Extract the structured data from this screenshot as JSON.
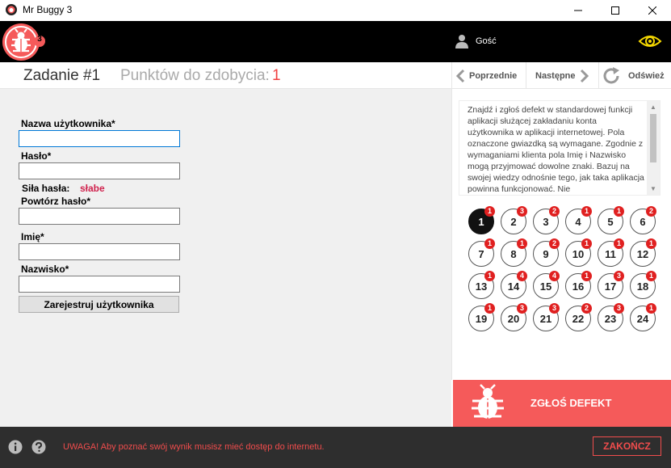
{
  "window": {
    "title": "Mr Buggy 3"
  },
  "header": {
    "logo_badge": "3",
    "user_name": "Gość"
  },
  "task": {
    "title": "Zadanie #1",
    "points_label": "Punktów do zdobycia:",
    "points_value": "1"
  },
  "nav": {
    "prev": "Poprzednie",
    "next": "Następne",
    "refresh": "Odśwież"
  },
  "form": {
    "username_label": "Nazwa użytkownika*",
    "password_label": "Hasło*",
    "strength_label": "Siła hasła:",
    "strength_value": "słabe",
    "password_repeat_label": "Powtórz hasło*",
    "first_name_label": "Imię*",
    "last_name_label": "Nazwisko*",
    "register_button": "Zarejestruj użytkownika"
  },
  "description": "Znajdź i zgłoś defekt w standardowej funkcji aplikacji służącej zakładaniu konta użytkownika w aplikacji internetowej. Pola oznaczone gwiazdką są wymagane. Zgodnie z wymaganiami klienta pola Imię i Nazwisko mogą przyjmować dowolne znaki. Bazuj na swojej wiedzy odnośnie tego, jak taka aplikacja powinna funkcjonować. Nie",
  "tasks": [
    {
      "n": "1",
      "b": "1"
    },
    {
      "n": "2",
      "b": "3"
    },
    {
      "n": "3",
      "b": "2"
    },
    {
      "n": "4",
      "b": "1"
    },
    {
      "n": "5",
      "b": "1"
    },
    {
      "n": "6",
      "b": "2"
    },
    {
      "n": "7",
      "b": "1"
    },
    {
      "n": "8",
      "b": "1"
    },
    {
      "n": "9",
      "b": "2"
    },
    {
      "n": "10",
      "b": "1"
    },
    {
      "n": "11",
      "b": "1"
    },
    {
      "n": "12",
      "b": "1"
    },
    {
      "n": "13",
      "b": "1"
    },
    {
      "n": "14",
      "b": "4"
    },
    {
      "n": "15",
      "b": "4"
    },
    {
      "n": "16",
      "b": "1"
    },
    {
      "n": "17",
      "b": "3"
    },
    {
      "n": "18",
      "b": "1"
    },
    {
      "n": "19",
      "b": "1"
    },
    {
      "n": "20",
      "b": "3"
    },
    {
      "n": "21",
      "b": "3"
    },
    {
      "n": "22",
      "b": "2"
    },
    {
      "n": "23",
      "b": "3"
    },
    {
      "n": "24",
      "b": "1"
    }
  ],
  "report": {
    "label": "ZGŁOŚ DEFEKT"
  },
  "footer": {
    "warning": "UWAGA! Aby poznać swój wynik musisz mieć dostęp do internetu.",
    "end_button": "ZAKOŃCZ"
  },
  "colors": {
    "accent": "#f55a5a",
    "header_bg": "#000000",
    "footer_bg": "#2e2e2e",
    "eye": "#f5d800",
    "badge": "#e02020"
  }
}
